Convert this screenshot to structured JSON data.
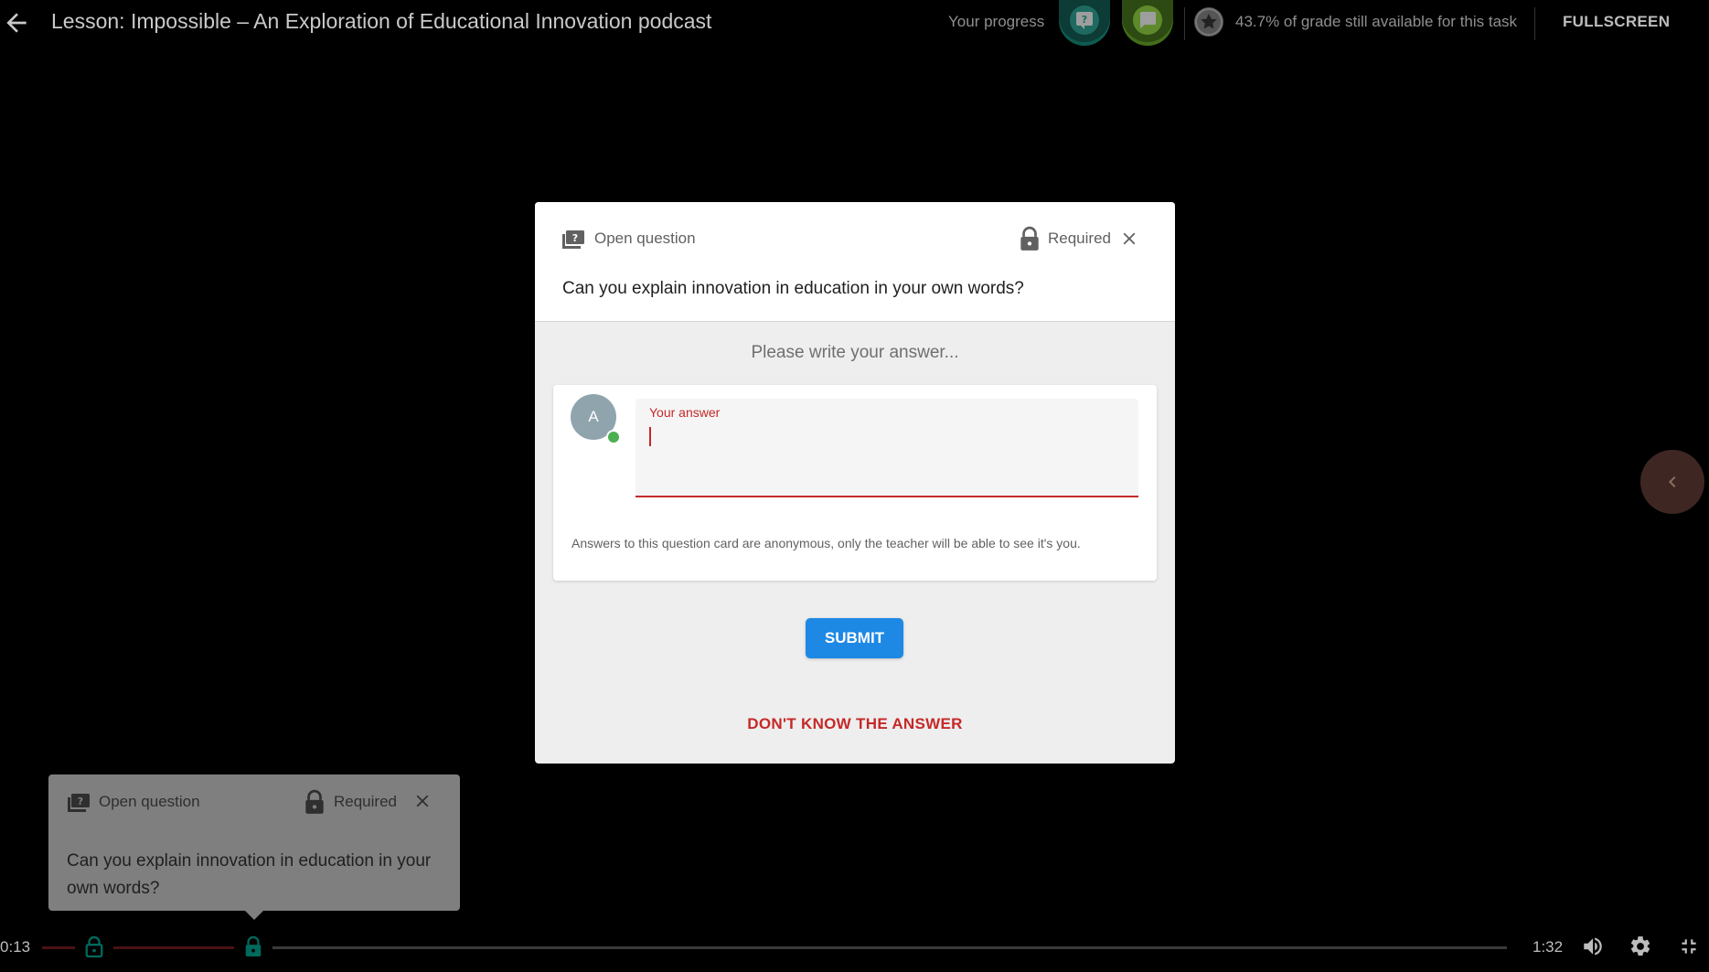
{
  "header": {
    "title": "Lesson: Impossible – An Exploration of Educational Innovation podcast",
    "progress_label": "Your progress",
    "grade_text": "43.7% of grade still available for this task",
    "fullscreen_label": "FULLSCREEN"
  },
  "modal": {
    "type_label": "Open question",
    "required_label": "Required",
    "question": "Can you explain innovation in education in your own words?",
    "prompt": "Please write your answer...",
    "avatar_initial": "A",
    "answer_label": "Your answer",
    "answer_value": "",
    "anonymous_note": "Answers to this question card are anonymous, only the teacher will be able to see it's you.",
    "submit_label": "SUBMIT",
    "dont_know_label": "DON'T KNOW THE ANSWER"
  },
  "tooltip_card": {
    "type_label": "Open question",
    "required_label": "Required",
    "question": "Can you explain innovation in education in your own words?"
  },
  "player": {
    "current_time": "0:13",
    "total_time": "1:32"
  },
  "colors": {
    "accent_red": "#c62828",
    "submit_blue": "#1e88e5",
    "quiz_marker": "#00695c",
    "online_green": "#4caf50"
  },
  "icons": [
    "back-arrow-icon",
    "question-bubble-icon",
    "comment-bubble-icon",
    "star-badge-icon",
    "chevron-left-icon",
    "lock-icon",
    "close-icon",
    "volume-icon",
    "gear-icon",
    "exit-fullscreen-icon"
  ]
}
